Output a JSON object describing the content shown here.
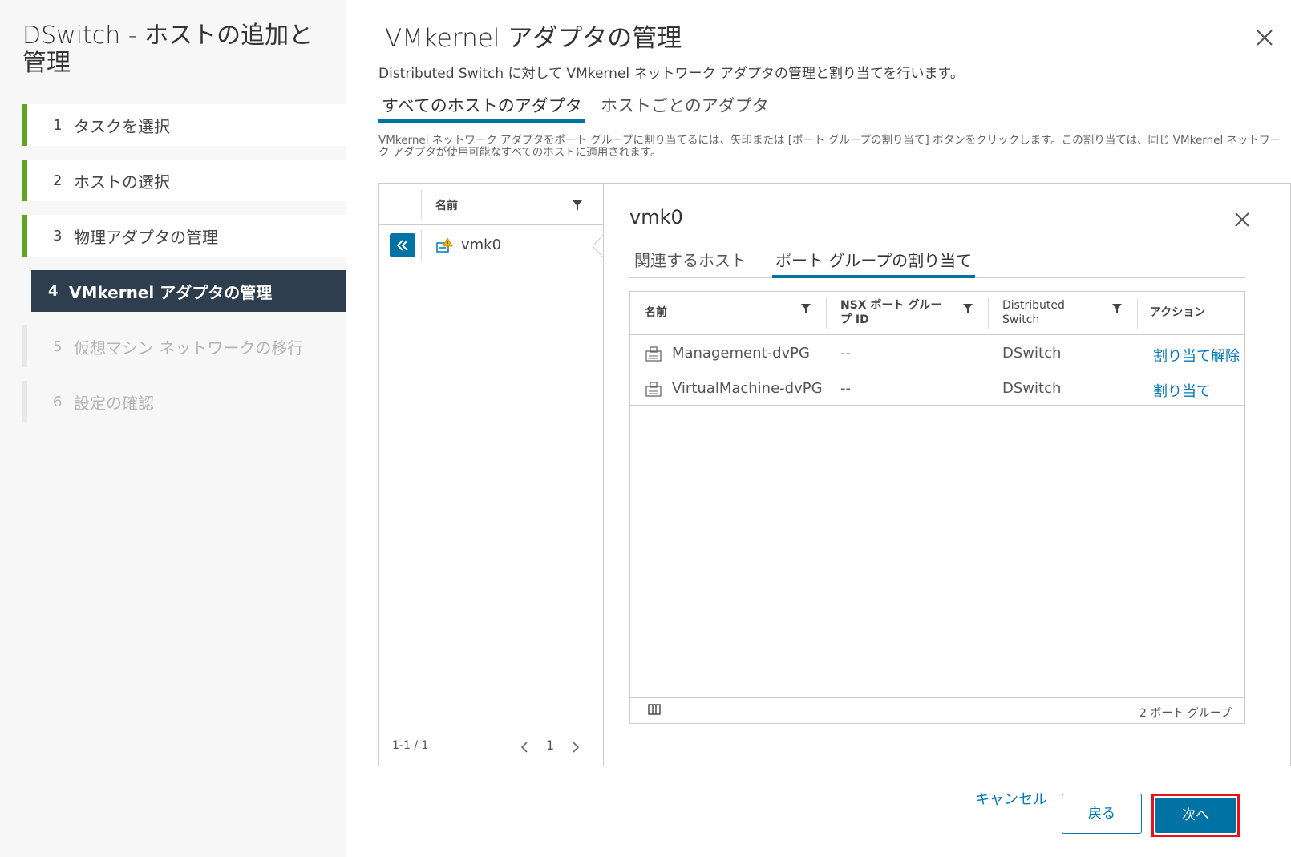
{
  "wizard": {
    "title": "DSwitch - ホストの追加と管理",
    "steps": [
      {
        "num": "1",
        "label": "タスクを選択",
        "state": "done"
      },
      {
        "num": "2",
        "label": "ホストの選択",
        "state": "done"
      },
      {
        "num": "3",
        "label": "物理アダプタの管理",
        "state": "done"
      },
      {
        "num": "4",
        "label": "VMkernel アダプタの管理",
        "state": "active"
      },
      {
        "num": "5",
        "label": "仮想マシン ネットワークの移行",
        "state": "disabled"
      },
      {
        "num": "6",
        "label": "設定の確認",
        "state": "disabled"
      }
    ]
  },
  "main": {
    "title": "VMkernel アダプタの管理",
    "description": "Distributed Switch に対して VMkernel ネットワーク アダプタの管理と割り当てを行います。",
    "tabs": [
      {
        "label": "すべてのホストのアダプタ",
        "active": true
      },
      {
        "label": "ホストごとのアダプタ",
        "active": false
      }
    ],
    "info_text": "VMkernel ネットワーク アダプタをポート グループに割り当てるには、矢印または [ポート グループの割り当て] ボタンをクリックします。この割り当ては、同じ VMkernel ネットワーク アダプタが使用可能なすべてのホストに適用されます。"
  },
  "master_list": {
    "column": "名前",
    "rows": [
      {
        "name": "vmk0",
        "icon": "vmkernel-warning-icon"
      }
    ],
    "footer_count": "1-1 / 1",
    "page": "1"
  },
  "detail": {
    "title": "vmk0",
    "tabs": [
      {
        "label": "関連するホスト",
        "active": false
      },
      {
        "label": "ポート グループの割り当て",
        "active": true
      }
    ],
    "columns": {
      "name": "名前",
      "nsx_line1": "NSX ポート グルー",
      "nsx_line2": "プ ID",
      "ds_line1": "Distributed",
      "ds_line2": "Switch",
      "action": "アクション"
    },
    "rows": [
      {
        "name": "Management-dvPG",
        "nsx": "--",
        "switch": "DSwitch",
        "action": "割り当て解除"
      },
      {
        "name": "VirtualMachine-dvPG",
        "nsx": "--",
        "switch": "DSwitch",
        "action": "割り当て"
      }
    ],
    "footer_total": "2 ポート グループ"
  },
  "buttons": {
    "cancel": "キャンセル",
    "back": "戻る",
    "next": "次へ"
  },
  "colors": {
    "accent": "#0072a3",
    "link": "#0079b8",
    "done": "#62a420",
    "active_step_bg": "#2e3e4f",
    "highlight": "#e8121b"
  }
}
